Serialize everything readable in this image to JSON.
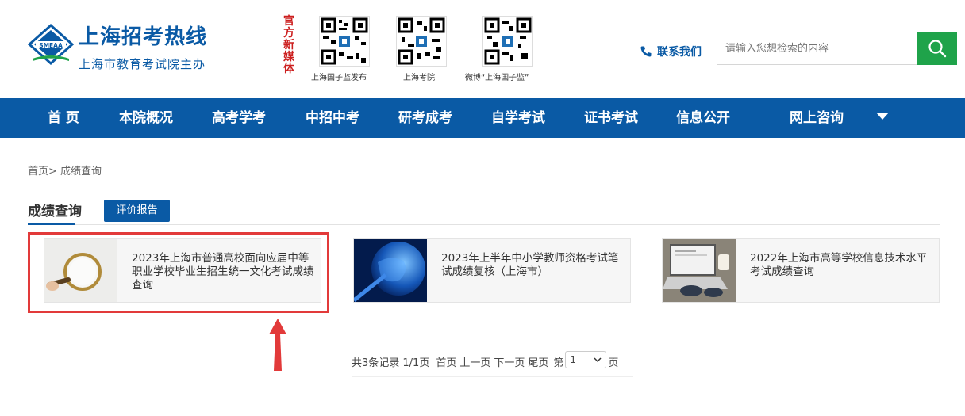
{
  "header": {
    "logo_title": "上海招考热线",
    "logo_subtitle": "上海市教育考试院主办",
    "logo_badge": "SMEAA",
    "media_label": "官方新媒体",
    "qrcodes": [
      {
        "caption": "上海国子监发布"
      },
      {
        "caption": "上海考院"
      },
      {
        "caption": "微博“上海国子监”"
      }
    ],
    "contact_label": "联系我们",
    "search_placeholder": "请输入您想检索的内容"
  },
  "nav": {
    "items": [
      "首 页",
      "本院概况",
      "高考学考",
      "中招中考",
      "研考成考",
      "自学考试",
      "证书考试",
      "信息公开",
      "网上咨询"
    ]
  },
  "breadcrumb": "首页> 成绩查询",
  "tabs": {
    "active": "成绩查询",
    "secondary": "评价报告"
  },
  "cards": [
    {
      "title": "2023年上海市普通高校面向应届中等职业学校毕业生招生统一文化考试成绩查询",
      "thumb": "magnifier"
    },
    {
      "title": "2023年上半年中小学教师资格考试笔试成绩复核（上海市）",
      "thumb": "globe"
    },
    {
      "title": "2022年上海市高等学校信息技术水平考试成绩查询",
      "thumb": "laptop"
    }
  ],
  "pagination": {
    "summary": "共3条记录 1/1页",
    "first": "首页",
    "prev": "上一页",
    "next": "下一页",
    "last": "尾页",
    "page_prefix": "第",
    "page_value": "1",
    "page_suffix": "页"
  },
  "colors": {
    "brand_blue": "#0a5aa5",
    "search_green": "#1fa34a",
    "highlight_red": "#e23a3a"
  }
}
